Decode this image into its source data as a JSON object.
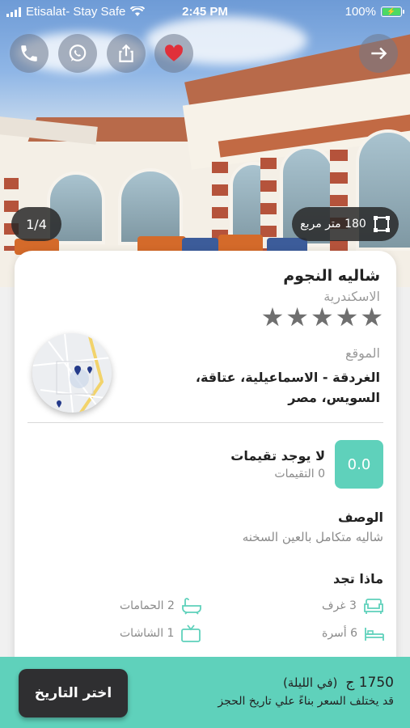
{
  "status_bar": {
    "carrier": "Etisalat- Stay Safe",
    "time": "2:45 PM",
    "battery": "100%"
  },
  "header": {
    "actions": [
      {
        "name": "phone",
        "icon": "phone-icon"
      },
      {
        "name": "whatsapp",
        "icon": "whatsapp-icon"
      },
      {
        "name": "share",
        "icon": "share-icon"
      },
      {
        "name": "favorite",
        "icon": "heart-icon"
      }
    ],
    "back_icon": "arrow-right-icon"
  },
  "gallery": {
    "counter": "1/4",
    "area": "180 متر مربع"
  },
  "listing": {
    "title": "شاليه النجوم",
    "city": "الاسكندرية",
    "stars": 5,
    "location_label": "الموقع",
    "location": "الغردقة - الاسماعيلية، عتاقة، السويس، مصر"
  },
  "reviews": {
    "score": "0.0",
    "no_reviews": "لا يوجد تقيمات",
    "count": "0 التقيمات"
  },
  "description": {
    "label": "الوصف",
    "text": "شاليه متكامل بالعين السخنه"
  },
  "amenities": {
    "label": "ماذا تجد",
    "items": [
      {
        "icon": "bathtub-icon",
        "text": "2 الحمامات"
      },
      {
        "icon": "sofa-icon",
        "text": "3 غرف"
      },
      {
        "icon": "tv-icon",
        "text": "1 الشاشات"
      },
      {
        "icon": "bed-icon",
        "text": "6 أسرة"
      }
    ]
  },
  "booking": {
    "price": "1750 ج",
    "per_night": "(في الليلة)",
    "note": "قد يختلف السعر بناءً علي تاريخ الحجز",
    "button": "اختر التاريخ"
  },
  "colors": {
    "accent": "#5fd1bb",
    "dark": "#2f2f31",
    "favorite": "#e0303a"
  }
}
